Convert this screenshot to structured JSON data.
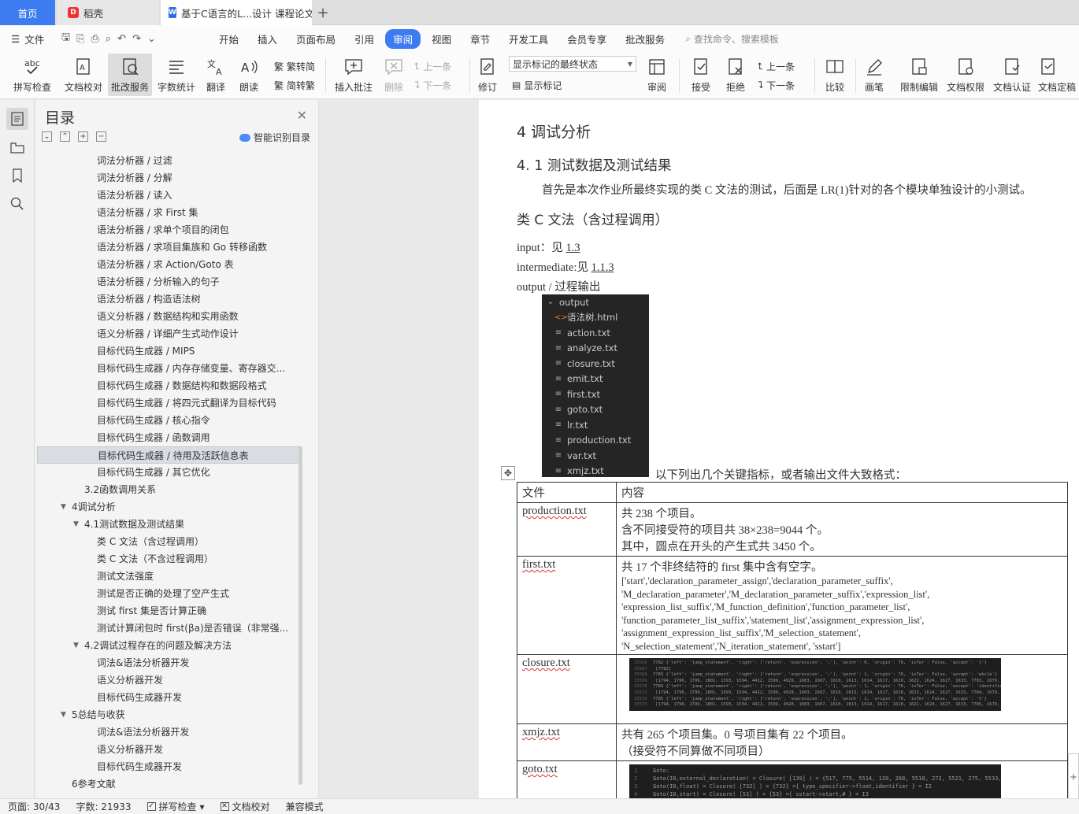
{
  "tabs": {
    "home": "首页",
    "daoke": "稻壳",
    "doc": "基于C语言的L...设计 课程论文",
    "add": "+"
  },
  "menu": {
    "file": "文件",
    "items": [
      "开始",
      "插入",
      "页面布局",
      "引用",
      "审阅",
      "视图",
      "章节",
      "开发工具",
      "会员专享",
      "批改服务"
    ],
    "active_index": 4,
    "search": "查找命令、搜索模板"
  },
  "ribbon": {
    "spell": "拼写检查",
    "doc_check": "文档校对",
    "correct": "批改服务",
    "word_count": "字数统计",
    "translate": "翻译",
    "read": "朗读",
    "trad": "繁转简",
    "simp": "简转繁",
    "insert_comment": "插入批注",
    "delete": "删除",
    "prev": "上一条",
    "next": "下一条",
    "revise": "修订",
    "markup_state": "显示标记的最终状态",
    "show_markup": "显示标记",
    "review": "审阅",
    "accept": "接受",
    "reject": "拒绝",
    "prev2": "上一条",
    "next2": "下一条",
    "compare": "比较",
    "pen": "画笔",
    "restrict": "限制编辑",
    "rights": "文档权限",
    "certify": "文档认证",
    "finalize": "文档定稿"
  },
  "toc": {
    "title": "目录",
    "smart": "智能识别目录",
    "items": [
      {
        "text": "词法分析器 / 过滤",
        "level": "lv3"
      },
      {
        "text": "词法分析器 / 分解",
        "level": "lv3"
      },
      {
        "text": "语法分析器 / 读入",
        "level": "lv3"
      },
      {
        "text": "语法分析器 / 求 First 集",
        "level": "lv3"
      },
      {
        "text": "语法分析器 / 求单个项目的闭包",
        "level": "lv3"
      },
      {
        "text": "语法分析器 / 求项目集族和 Go 转移函数",
        "level": "lv3"
      },
      {
        "text": "语法分析器 / 求 Action/Goto 表",
        "level": "lv3"
      },
      {
        "text": "语法分析器 / 分析输入的句子",
        "level": "lv3"
      },
      {
        "text": "语法分析器 / 构造语法树",
        "level": "lv3"
      },
      {
        "text": "语义分析器 / 数据结构和实用函数",
        "level": "lv3"
      },
      {
        "text": "语义分析器 / 详细产生式动作设计",
        "level": "lv3"
      },
      {
        "text": "目标代码生成器 / MIPS",
        "level": "lv3"
      },
      {
        "text": "目标代码生成器 / 内存存储变量、寄存器交...",
        "level": "lv3"
      },
      {
        "text": "目标代码生成器 / 数据结构和数据段格式",
        "level": "lv3"
      },
      {
        "text": "目标代码生成器 / 将四元式翻译为目标代码",
        "level": "lv3"
      },
      {
        "text": "目标代码生成器 / 核心指令",
        "level": "lv3"
      },
      {
        "text": "目标代码生成器 / 函数调用",
        "level": "lv3"
      },
      {
        "text": "目标代码生成器 / 待用及活跃信息表",
        "level": "lv3",
        "selected": true
      },
      {
        "text": "目标代码生成器 / 其它优化",
        "level": "lv3"
      },
      {
        "text": "3.2函数调用关系",
        "level": "lv2"
      },
      {
        "text": "4调试分析",
        "level": "lv1c",
        "arrow": true
      },
      {
        "text": "4.1测试数据及测试结果",
        "level": "lv2c",
        "arrow": true
      },
      {
        "text": "类 C 文法（含过程调用）",
        "level": "lv3"
      },
      {
        "text": "类 C 文法（不含过程调用）",
        "level": "lv3"
      },
      {
        "text": "测试文法强度",
        "level": "lv3"
      },
      {
        "text": "测试是否正确的处理了空产生式",
        "level": "lv3"
      },
      {
        "text": "测试 first 集是否计算正确",
        "level": "lv3"
      },
      {
        "text": "测试计算闭包时 first(βa)是否错误（非常强...",
        "level": "lv3"
      },
      {
        "text": "4.2调试过程存在的问题及解决方法",
        "level": "lv2c",
        "arrow": true
      },
      {
        "text": "词法&语法分析器开发",
        "level": "lv3"
      },
      {
        "text": "语义分析器开发",
        "level": "lv3"
      },
      {
        "text": "目标代码生成器开发",
        "level": "lv3"
      },
      {
        "text": "5总结与收获",
        "level": "lv1c",
        "arrow": true
      },
      {
        "text": "词法&语法分析器开发",
        "level": "lv3"
      },
      {
        "text": "语义分析器开发",
        "level": "lv3"
      },
      {
        "text": "目标代码生成器开发",
        "level": "lv3"
      },
      {
        "text": "6参考文献",
        "level": "lv1c"
      }
    ]
  },
  "doc": {
    "h1": "4 调试分析",
    "h2": "4. 1 测试数据及测试结果",
    "para": "首先是本次作业所最终实现的类 C 文法的测试，后面是 LR(1)针对的各个模块单独设计的小测试。",
    "h3": "类 C 文法（含过程调用）",
    "input_label": "input：见 ",
    "input_ref": "1.3",
    "inter_label": "intermediate:见 ",
    "inter_ref": "1.1.3",
    "output_label": "output / 过程输出",
    "after_image": "以下列出几个关键指标，或者输出文件大致格式：",
    "filetree": {
      "root": "output",
      "files": [
        "语法树.html",
        "action.txt",
        "analyze.txt",
        "closure.txt",
        "emit.txt",
        "first.txt",
        "goto.txt",
        "lr.txt",
        "production.txt",
        "var.txt",
        "xmjz.txt"
      ]
    },
    "table": {
      "head": [
        "文件",
        "内容"
      ],
      "production_name": "production.txt",
      "production_lines": [
        "共 238 个项目。",
        "含不同接受符的项目共 38×238=9044 个。",
        "其中，圆点在开头的产生式共 3450 个。"
      ],
      "first_name": "first.txt",
      "first_head": "共 17 个非终结符的 first 集中含有空字。",
      "first_list": [
        "['start','declaration_parameter_assign','declaration_parameter_suffix',",
        "'M_declaration_parameter','M_declaration_parameter_suffix','expression_list',",
        "'expression_list_suffix','M_function_definition','function_parameter_list',",
        "'function_parameter_list_suffix','statement_list','assignment_expression_list',",
        "'assignment_expression_list_suffix','M_selection_statement',",
        "'N_selection_statement','N_iteration_statement', 'sstart']"
      ],
      "closure_name": "closure.txt",
      "closure_code": [
        {
          "ln": "15566",
          "text": "7782  {'left': 'jump_statement', 'right': ['return', 'expression', ';'], 'point': 0, 'origin': 76, 'isTer': False, 'accept': '}'}"
        },
        {
          "ln": "15567",
          "text": "      [7782]"
        },
        {
          "ln": "15568",
          "text": "7783  {'left': 'jump_statement', 'right': ['return', 'expression', ';'], 'point': 1, 'origin': 76, 'isTer': False, 'accept': 'while'}"
        },
        {
          "ln": "15569",
          "text": "      [1794, 1796, 1799, 1801, 1593, 1594, 4412, 1599, 4928, 1603, 1607, 1610, 1613, 1614, 1617, 1618, 1622, 1624, 1627, 1633, 7783, 1679, 1680,"
        },
        {
          "ln": "15570",
          "text": "7784  {'left': 'jump_statement', 'right': ['return', 'expression', ';'], 'point': 1, 'origin': 76, 'isTer': False, 'accept': 'identifier'}"
        },
        {
          "ln": "15571",
          "text": "      [1794, 1796, 1799, 1801, 1593, 1594, 4412, 1599, 4928, 1603, 1607, 1610, 1613, 1614, 1617, 1618, 1622, 1624, 1627, 1633, 7784, 1679, 1680,"
        },
        {
          "ln": "15572",
          "text": "7785  {'left': 'jump_statement', 'right': ['return', 'expression', ';'], 'point': 1, 'origin': 76, 'isTer': False, 'accept': '%'}"
        },
        {
          "ln": "15573",
          "text": "      [1794, 1796, 1799, 1801, 1593, 1594, 4412, 1599, 4928, 1603, 1607, 1610, 1613, 1614, 1617, 1618, 1622, 1624, 1627, 1633, 7785, 1679, 1680,"
        }
      ],
      "xmjz_name": "xmjz.txt",
      "xmjz_lines": [
        "共有 265 个项目集。0 号项目集有 22 个项目。",
        "（接受符不同算做不同项目）"
      ],
      "goto_name": "goto.txt",
      "goto_code": [
        {
          "ln": "1",
          "text": "Goto:"
        },
        {
          "ln": "2",
          "text": "Goto(I0,external_declaration) = Closure( [139] ) = {517, 775, 5514, 139, 268, 5518, 272, 5521, 275, 5533, 53"
        },
        {
          "ln": "3",
          "text": "Goto(I0,float) = Closure( [732] ) = {732} ={ type_specifier->float,identifier } = I2"
        },
        {
          "ln": "4",
          "text": "Goto(I0,start) = Closure( [53] ) = {53} ={ sstart->start,# } = I3"
        }
      ]
    }
  },
  "status": {
    "page": "页面: 30/43",
    "words": "字数: 21933",
    "spell": "拼写检查",
    "check": "文档校对",
    "compat": "兼容模式"
  },
  "colors": {
    "accent": "#3d7cf0",
    "code_bg": "#1e1e1e",
    "tree_bg": "#252526"
  }
}
